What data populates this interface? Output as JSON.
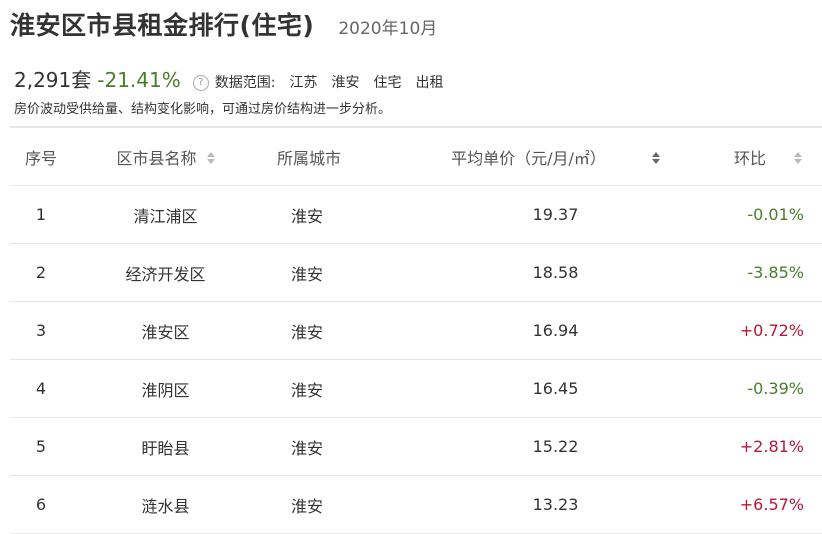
{
  "header": {
    "title": "淮安区市县租金排行(住宅)",
    "period": "2020年10月"
  },
  "summary": {
    "count": "2,291套",
    "change": "-21.41%",
    "help_icon": "question-circle-icon",
    "scope_label": "数据范围:",
    "scope": [
      "江苏",
      "淮安",
      "住宅",
      "出租"
    ],
    "note": "房价波动受供给量、结构变化影响，可通过房价结构进一步分析。"
  },
  "table": {
    "headers": {
      "index": "序号",
      "name": "区市县名称",
      "city": "所属城市",
      "price": "平均单价（元/月/㎡）",
      "change": "环比"
    },
    "rows": [
      {
        "index": "1",
        "name": "清江浦区",
        "city": "淮安",
        "price": "19.37",
        "change": "-0.01%"
      },
      {
        "index": "2",
        "name": "经济开发区",
        "city": "淮安",
        "price": "18.58",
        "change": "-3.85%"
      },
      {
        "index": "3",
        "name": "淮安区",
        "city": "淮安",
        "price": "16.94",
        "change": "+0.72%"
      },
      {
        "index": "4",
        "name": "淮阴区",
        "city": "淮安",
        "price": "16.45",
        "change": "-0.39%"
      },
      {
        "index": "5",
        "name": "盱眙县",
        "city": "淮安",
        "price": "15.22",
        "change": "+2.81%"
      },
      {
        "index": "6",
        "name": "涟水县",
        "city": "淮安",
        "price": "13.23",
        "change": "+6.57%"
      }
    ]
  },
  "colors": {
    "negative": "#4a7d2a",
    "positive": "#b5173a"
  }
}
